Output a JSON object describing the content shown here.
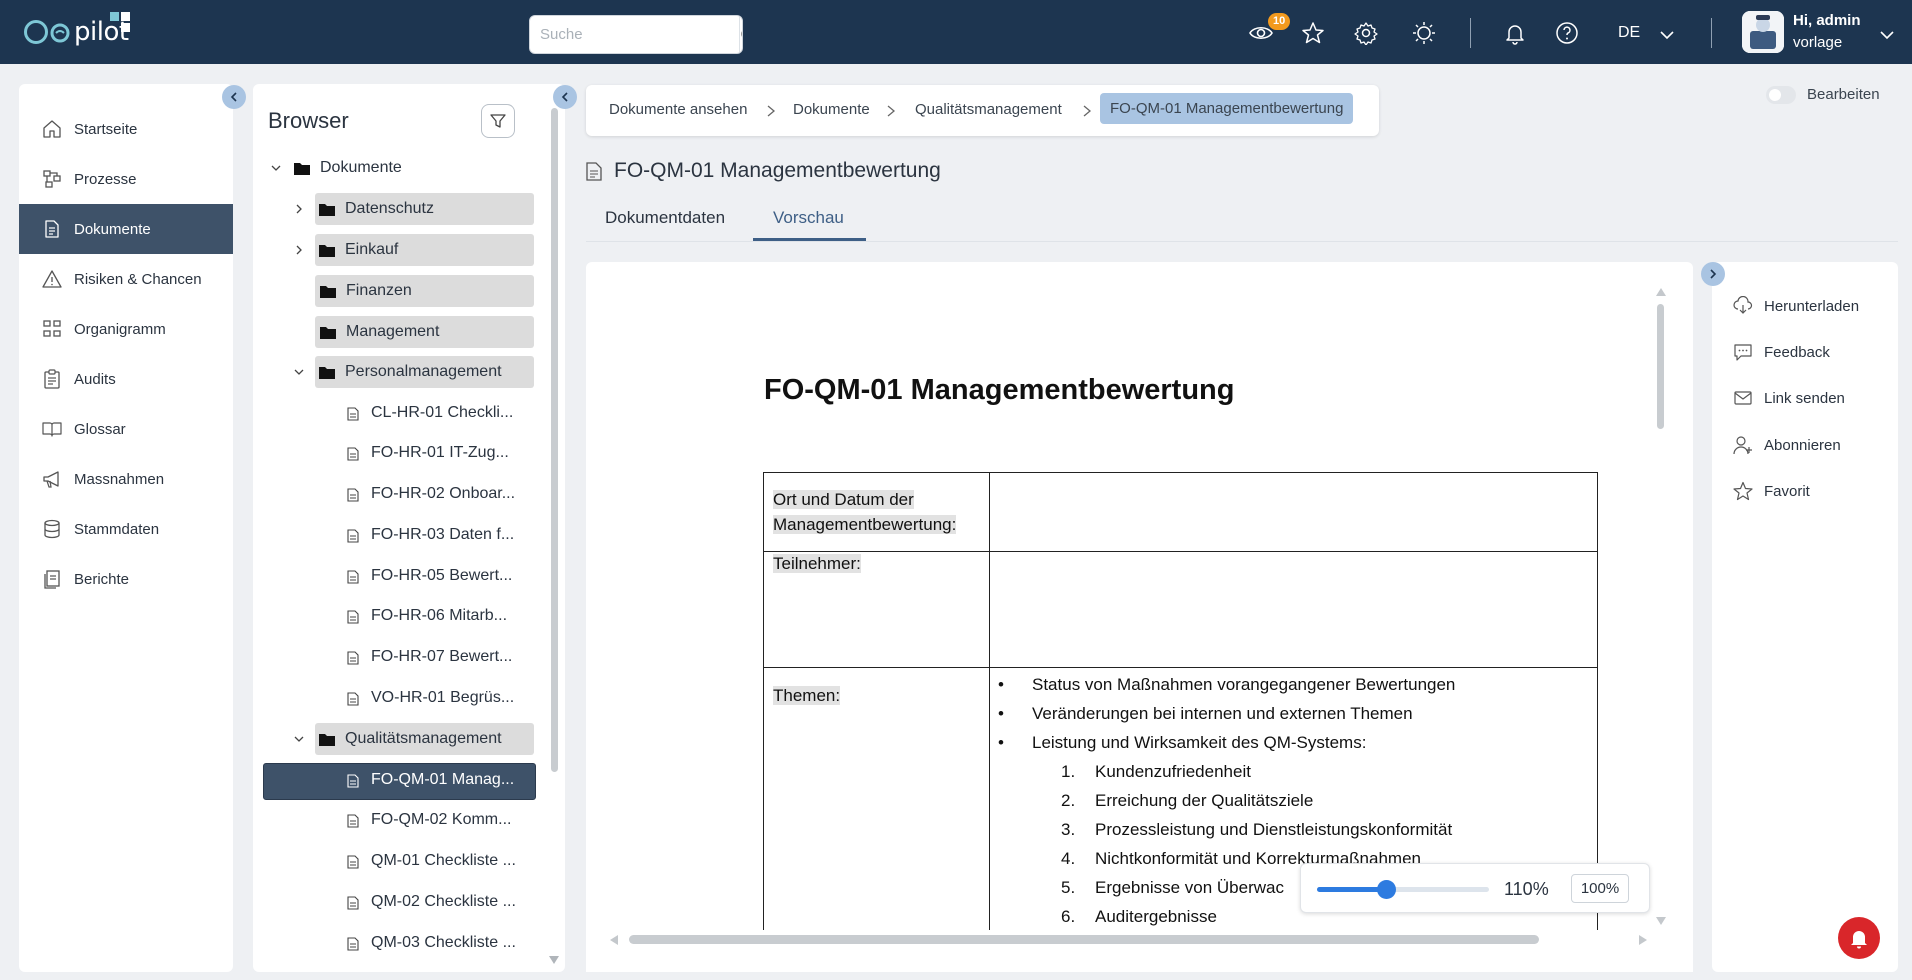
{
  "app": {
    "logo_prefix": "qm",
    "logo_text": "pilot"
  },
  "header": {
    "search_placeholder": "Suche",
    "notifications_count": "10",
    "language": "DE",
    "user_greeting": "Hi, admin",
    "user_sub": "vorlage"
  },
  "sidebar": {
    "items": [
      {
        "label": "Startseite",
        "icon": "home-icon"
      },
      {
        "label": "Prozesse",
        "icon": "process-icon"
      },
      {
        "label": "Dokumente",
        "icon": "document-icon",
        "active": true
      },
      {
        "label": "Risiken & Chancen",
        "icon": "warning-icon"
      },
      {
        "label": "Organigramm",
        "icon": "org-chart-icon"
      },
      {
        "label": "Audits",
        "icon": "clipboard-icon"
      },
      {
        "label": "Glossar",
        "icon": "book-icon"
      },
      {
        "label": "Massnahmen",
        "icon": "megaphone-icon"
      },
      {
        "label": "Stammdaten",
        "icon": "database-icon"
      },
      {
        "label": "Berichte",
        "icon": "report-icon"
      }
    ]
  },
  "browser": {
    "title": "Browser",
    "tree": [
      "Dokumente",
      "Datenschutz",
      "Einkauf",
      "Finanzen",
      "Management",
      "Personalmanagement",
      "CL-HR-01 Checkli...",
      "FO-HR-01 IT-Zug...",
      "FO-HR-02 Onboar...",
      "FO-HR-03 Daten f...",
      "FO-HR-05 Bewert...",
      "FO-HR-06 Mitarb...",
      "FO-HR-07 Bewert...",
      "VO-HR-01 Begrüs...",
      "Qualitätsmanagement",
      "FO-QM-01 Manag...",
      "FO-QM-02 Komm...",
      "QM-01 Checkliste ...",
      "QM-02 Checkliste ...",
      "QM-03 Checkliste ..."
    ]
  },
  "breadcrumb": [
    "Dokumente ansehen",
    "Dokumente",
    "Qualitätsmanagement",
    "FO-QM-01 Managementbewertung"
  ],
  "edit_label": "Bearbeiten",
  "document": {
    "title": "FO-QM-01 Managementbewertung",
    "tabs": [
      "Dokumentdaten",
      "Vorschau"
    ],
    "active_tab": "Vorschau",
    "preview": {
      "heading": "FO-QM-01 Managementbewertung",
      "row1_label_a": "Ort und Datum der",
      "row1_label_b": "Managementbewertung:",
      "row2_label": "Teilnehmer:",
      "row3_label": "Themen:",
      "bullets": [
        "Status von Maßnahmen vorangegangener Bewertungen",
        "Veränderungen bei internen und externen Themen",
        "Leistung und Wirksamkeit des QM-Systems:"
      ],
      "numbered": [
        "Kundenzufriedenheit",
        "Erreichung der Qualitätsziele",
        "Prozessleistung und Dienstleistungskonformität",
        "Nichtkonformität und Korrekturmaßnahmen",
        "Ergebnisse von Überwac",
        "Auditergebnisse"
      ],
      "numbers": [
        "1.",
        "2.",
        "3.",
        "4.",
        "5.",
        "6."
      ],
      "bullet_symbol": "•"
    },
    "zoom": {
      "value": "110%",
      "reset_label": "100%",
      "level_fraction": 0.4
    }
  },
  "actions": [
    {
      "label": "Herunterladen",
      "icon": "cloud-download-icon"
    },
    {
      "label": "Feedback",
      "icon": "feedback-icon"
    },
    {
      "label": "Link senden",
      "icon": "mail-icon"
    },
    {
      "label": "Abonnieren",
      "icon": "subscribe-user-icon"
    },
    {
      "label": "Favorit",
      "icon": "star-icon"
    }
  ],
  "colors": {
    "header": "#1d3550",
    "active_nav": "#3e5269",
    "accent": "#a9c4e2",
    "badge": "#f39a1e",
    "fab": "#d9262a"
  }
}
